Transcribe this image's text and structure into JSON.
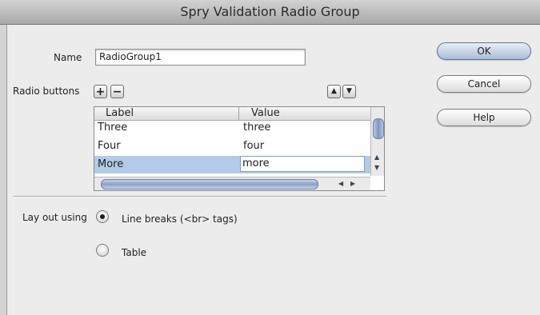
{
  "window": {
    "title": "Spry Validation Radio Group"
  },
  "form": {
    "name_label": "Name",
    "name_value": "RadioGroup1",
    "radio_buttons_label": "Radio buttons",
    "add_icon": "+",
    "remove_icon": "−",
    "move_up_icon": "▲",
    "move_down_icon": "▼"
  },
  "grid": {
    "columns": [
      "Label",
      "Value"
    ],
    "rows": [
      {
        "label": "Three",
        "value": "three"
      },
      {
        "label": "Four",
        "value": "four"
      },
      {
        "label": "More",
        "value": "more"
      }
    ]
  },
  "layout": {
    "label": "Lay out using",
    "options": [
      {
        "label": "Line breaks (<br> tags)",
        "selected": true
      },
      {
        "label": "Table",
        "selected": false
      }
    ]
  },
  "buttons": {
    "ok": "OK",
    "cancel": "Cancel",
    "help": "Help"
  }
}
